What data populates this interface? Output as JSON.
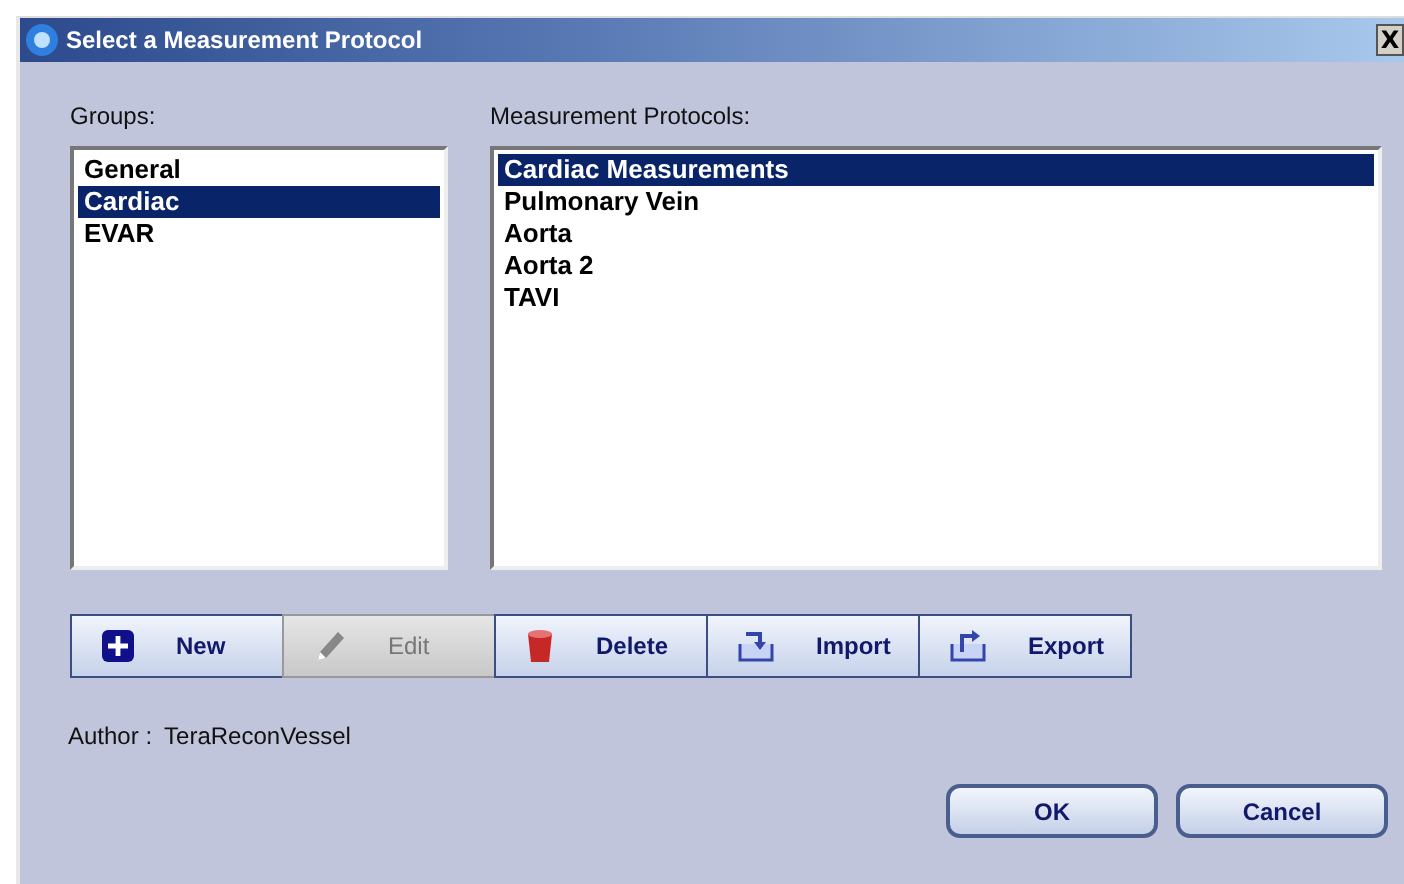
{
  "window": {
    "title": "Select a Measurement Protocol",
    "close": "X"
  },
  "groups": {
    "label": "Groups:",
    "items": [
      {
        "label": "General",
        "selected": false
      },
      {
        "label": "Cardiac",
        "selected": true
      },
      {
        "label": "EVAR",
        "selected": false
      }
    ]
  },
  "protocols": {
    "label": "Measurement Protocols:",
    "items": [
      {
        "label": "Cardiac Measurements",
        "selected": true
      },
      {
        "label": "Pulmonary Vein",
        "selected": false
      },
      {
        "label": "Aorta",
        "selected": false
      },
      {
        "label": "Aorta 2",
        "selected": false
      },
      {
        "label": "TAVI",
        "selected": false
      }
    ]
  },
  "toolbar": [
    {
      "kind": "new",
      "label": "New",
      "disabled": false
    },
    {
      "kind": "edit",
      "label": "Edit",
      "disabled": true
    },
    {
      "kind": "delete",
      "label": "Delete",
      "disabled": false
    },
    {
      "kind": "import",
      "label": "Import",
      "disabled": false
    },
    {
      "kind": "export",
      "label": "Export",
      "disabled": false
    }
  ],
  "author": {
    "label": "Author :",
    "value": "TeraReconVessel"
  },
  "buttons": [
    "OK",
    "Cancel"
  ]
}
